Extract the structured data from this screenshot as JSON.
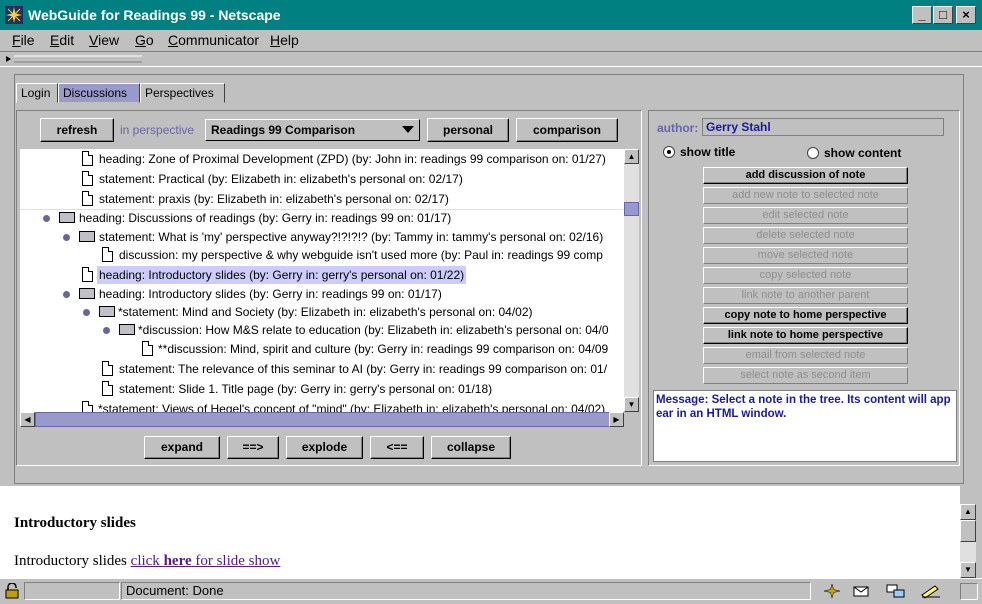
{
  "window": {
    "title": "WebGuide for Readings 99 - Netscape"
  },
  "menu": [
    "File",
    "Edit",
    "View",
    "Go",
    "Communicator",
    "Help"
  ],
  "tabs": [
    "Login",
    "Discussions",
    "Perspectives"
  ],
  "toolbar": {
    "refresh": "refresh",
    "in_perspective_label": "in perspective",
    "perspective_value": "Readings 99 Comparison",
    "personal": "personal",
    "comparison": "comparison"
  },
  "tree": [
    {
      "text": "heading:  Zone of Proximal Development (ZPD)  (by: John in: readings 99 comparison on: 01/27)"
    },
    {
      "text": "statement:  Practical  (by: Elizabeth in: elizabeth's personal on: 02/17)"
    },
    {
      "text": "statement:  praxis  (by: Elizabeth in: elizabeth's personal on: 02/17)"
    },
    {
      "text": "heading:  Discussions of readings  (by: Gerry in: readings 99 on: 01/17)"
    },
    {
      "text": "statement:  What is 'my' perspective anyway?!?!?!?  (by: Tammy in: tammy's personal on: 02/16)"
    },
    {
      "text": "discussion:  my perspective & why webguide isn't used more  (by: Paul in: readings 99 comp"
    },
    {
      "text": "heading:  Introductory slides  (by: Gerry in: gerry's personal on: 01/22)"
    },
    {
      "text": "heading:  Introductory slides  (by: Gerry in: readings 99 on: 01/17)"
    },
    {
      "text": "*statement:  Mind and Society  (by: Elizabeth in: elizabeth's personal on: 04/02)"
    },
    {
      "text": "*discussion:  How M&S relate to education  (by: Elizabeth in: elizabeth's personal on: 04/0"
    },
    {
      "text": "**discussion:  Mind, spirit and culture  (by: Gerry in: readings 99 comparison on: 04/09"
    },
    {
      "text": "statement:  The relevance of this seminar to AI  (by: Gerry in: readings 99 comparison on: 01/"
    },
    {
      "text": "statement:  Slide 1. Title page  (by: Gerry in: gerry's personal on: 01/18)"
    },
    {
      "text": "*statement:  Views of Hegel's concept of \"mind\"  (by: Elizabeth in: elizabeth's personal on: 04/02)"
    }
  ],
  "tree_buttons": [
    "expand",
    "==>",
    "explode",
    "<==",
    "collapse"
  ],
  "right": {
    "author_label": "author:",
    "author_value": "Gerry Stahl",
    "show_title": "show title",
    "show_content": "show content",
    "buttons": [
      {
        "label": "add discussion of note",
        "enabled": true
      },
      {
        "label": "add new note to selected note",
        "enabled": false
      },
      {
        "label": "edit selected note",
        "enabled": false
      },
      {
        "label": "delete selected note",
        "enabled": false
      },
      {
        "label": "move selected note",
        "enabled": false
      },
      {
        "label": "copy selected note",
        "enabled": false
      },
      {
        "label": "link note to another parent",
        "enabled": false
      },
      {
        "label": "copy note to home perspective",
        "enabled": true
      },
      {
        "label": "link note to home perspective",
        "enabled": true
      },
      {
        "label": "email from selected note",
        "enabled": false
      },
      {
        "label": "select note as second item",
        "enabled": false
      }
    ],
    "message_line1": "Message: Select a note in the tree. Its content will app",
    "message_line2": "ear in an HTML window."
  },
  "content": {
    "heading": "Introductory slides",
    "text_prefix": "Introductory slides ",
    "link_pre": "click ",
    "link_bold": "here",
    "link_post": " for slide show"
  },
  "status": {
    "text": "Document: Done"
  },
  "colors": {
    "titlebar": "#008080",
    "selected_tab": "#9999cc",
    "message": "#1a1aa0",
    "link": "#551a8b"
  }
}
